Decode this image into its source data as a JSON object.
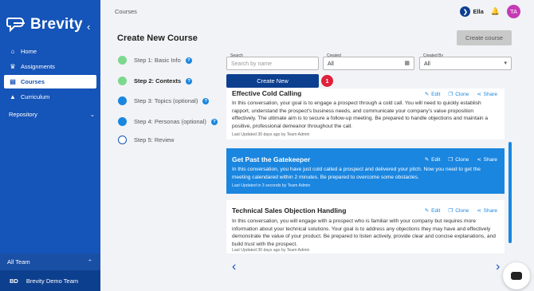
{
  "sidebar": {
    "brand": "Brevity",
    "items": [
      {
        "label": "Home",
        "icon": "home-icon"
      },
      {
        "label": "Assignments",
        "icon": "trophy-icon"
      },
      {
        "label": "Courses",
        "icon": "book-icon",
        "active": true
      },
      {
        "label": "Curriculum",
        "icon": "graduation-cap-icon"
      }
    ],
    "repository": "Repository",
    "team": "All Team",
    "org_initials": "BD",
    "org_name": "Brevity Demo Team"
  },
  "header": {
    "breadcrumb": "Courses",
    "user_name": "Ella",
    "avatar_initials": "TA"
  },
  "page": {
    "title": "Create New Course",
    "create_button": "Create course"
  },
  "steps": [
    {
      "label": "Step 1: Basic Info",
      "state": "done"
    },
    {
      "label": "Step 2: Contexts",
      "state": "current"
    },
    {
      "label": "Step 3: Topics (optional)",
      "state": "pending"
    },
    {
      "label": "Step 4: Personas (optional)",
      "state": "pending"
    },
    {
      "label": "Step 5: Review",
      "state": "empty"
    }
  ],
  "filters": {
    "search_label": "Search",
    "search_placeholder": "Search by name",
    "created_label": "Created",
    "created_value": "All",
    "created_by_label": "Created By",
    "created_by_value": "All"
  },
  "create_new": "Create New",
  "badge": "1",
  "actions": {
    "edit": "Edit",
    "clone": "Clone",
    "share": "Share"
  },
  "courses": [
    {
      "title": "Effective Cold Calling",
      "body": "In this conversation, your goal is to engage a prospect through a cold call. You will need to quickly establish rapport, understand the prospect's business needs, and communicate your company's value proposition effectively. The ultimate aim is to secure a follow-up meeting. Be prepared to handle objections and maintain a positive, professional demeanor throughout the call.",
      "meta": "Last Updated 30 days ago by Team Admin"
    },
    {
      "title": "Get Past the Gatekeeper",
      "body": "In this conversation, you have just cold called a prospect and delivered your pitch. Now you need to get the meeting calendared within 2 minutes. Be prepared to overcome some obstacles.",
      "meta": "Last Updated in 3 seconds by Team Admin"
    },
    {
      "title": "Technical Sales Objection Handling",
      "body": "In this conversation, you will engage with a prospect who is familiar with your company but requires more information about your technical solutions. Your goal is to address any objections they may have and effectively demonstrate the value of your product. Be prepared to listen actively, provide clear and concise explanations, and build trust with the prospect.",
      "meta": "Last Updated 30 days ago by Team Admin"
    }
  ],
  "colors": {
    "brand": "#1554b8",
    "selected": "#1a86e0",
    "done": "#7cd88d",
    "badge": "#e0203a"
  }
}
